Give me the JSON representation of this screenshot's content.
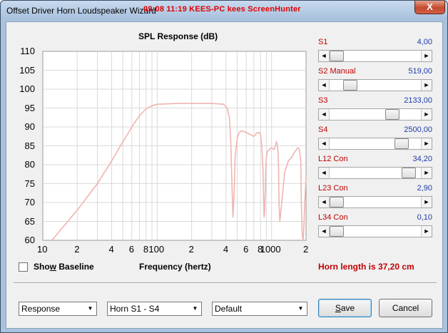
{
  "window": {
    "title": "Offset Driver Horn Loudspeaker Wizard",
    "watermark": "09:08  11:19  KEES-PC  kees  ScreenHunter",
    "close_glyph": "X"
  },
  "chart_data": {
    "type": "line",
    "title": "SPL Response (dB)",
    "xlabel": "Frequency (hertz)",
    "ylabel": "",
    "xscale": "log",
    "xlim": [
      10,
      2000
    ],
    "ylim": [
      60,
      110
    ],
    "grid": true,
    "yticks": [
      "110",
      "105",
      "100",
      "95",
      "90",
      "85",
      "80",
      "75",
      "70",
      "65",
      "60"
    ],
    "xticks": [
      {
        "value": 10,
        "label": "10"
      },
      {
        "value": 20,
        "label": "2"
      },
      {
        "value": 40,
        "label": "4"
      },
      {
        "value": 60,
        "label": "6"
      },
      {
        "value": 80,
        "label": "8"
      },
      {
        "value": 100,
        "label": "100"
      },
      {
        "value": 200,
        "label": "2"
      },
      {
        "value": 400,
        "label": "4"
      },
      {
        "value": 600,
        "label": "6"
      },
      {
        "value": 800,
        "label": "8"
      },
      {
        "value": 1000,
        "label": "1000"
      },
      {
        "value": 2000,
        "label": "2"
      }
    ],
    "series": [
      {
        "color": "#f0b4b0",
        "x": [
          12,
          20,
          30,
          40,
          50,
          60,
          70,
          80,
          90,
          100,
          150,
          200,
          300,
          380,
          410,
          430,
          440,
          450,
          460,
          470,
          480,
          500,
          520,
          550,
          600,
          650,
          700,
          750,
          780,
          800,
          820,
          840,
          850,
          860,
          870,
          880,
          890,
          900,
          920,
          950,
          1000,
          1050,
          1080,
          1100,
          1120,
          1140,
          1150,
          1160,
          1180,
          1200,
          1300,
          1400,
          1500,
          1600,
          1700,
          1750,
          1800,
          1820,
          1850,
          1880,
          1900,
          1950,
          2000
        ],
        "y": [
          60,
          68,
          75,
          81,
          86,
          90,
          93,
          94.8,
          95.6,
          96,
          96.2,
          96.2,
          96.2,
          96,
          95,
          92,
          86,
          75,
          66,
          72,
          82,
          87,
          88.5,
          89,
          88.5,
          88,
          87.5,
          88.5,
          88.5,
          88,
          85,
          79,
          72,
          66,
          68,
          73,
          79,
          82,
          83.5,
          84,
          84.5,
          84,
          85,
          86,
          85.5,
          83,
          79,
          70,
          65,
          67,
          78,
          81,
          82,
          83.5,
          84.5,
          84,
          81,
          70,
          62,
          60,
          61,
          70,
          77
        ]
      }
    ]
  },
  "baseline": {
    "label": "Show Baseline",
    "checked": false
  },
  "sliders": [
    {
      "name": "S1",
      "label": "S1",
      "value": "4,00",
      "pos": 0.0
    },
    {
      "name": "S2",
      "label": "S2  Manual",
      "value": "519,00",
      "pos": 0.17
    },
    {
      "name": "S3",
      "label": "S3",
      "value": "2133,00",
      "pos": 0.71
    },
    {
      "name": "S4",
      "label": "S4",
      "value": "2500,00",
      "pos": 0.83
    },
    {
      "name": "L12",
      "label": "L12  Con",
      "value": "34,20",
      "pos": 0.92
    },
    {
      "name": "L23",
      "label": "L23  Con",
      "value": "2,90",
      "pos": 0.0
    },
    {
      "name": "L34",
      "label": "L34  Con",
      "value": "0,10",
      "pos": 0.0
    }
  ],
  "horn_length": "Horn length is 37,20 cm",
  "dropdowns": {
    "view": "Response",
    "section": "Horn S1 - S4",
    "preset": "Default"
  },
  "buttons": {
    "save": "Save",
    "cancel": "Cancel"
  },
  "glyphs": {
    "left": "◄",
    "right": "►",
    "down": "▼"
  },
  "colors": {
    "curve": "#f0b4b0",
    "label_red": "#c00000",
    "value_blue": "#1e3ca8"
  }
}
